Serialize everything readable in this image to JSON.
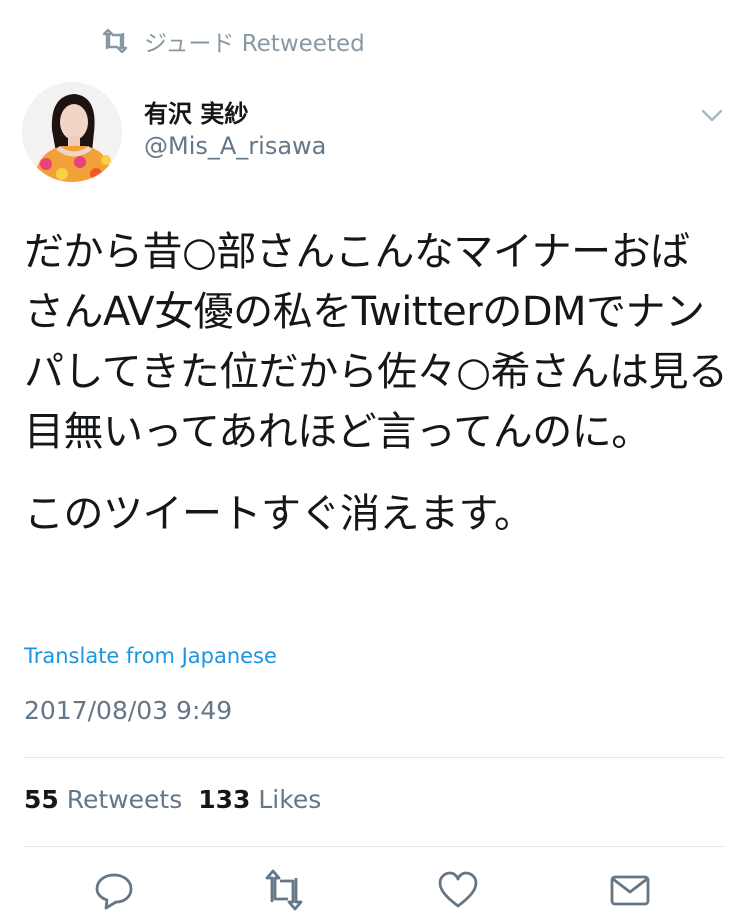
{
  "retweet_context": {
    "icon": "retweet-icon",
    "text": "ジュード Retweeted"
  },
  "author": {
    "display_name": "有沢 実紗",
    "handle": "@Mis_A_risawa"
  },
  "tweet": {
    "paragraphs": [
      "だから昔○部さんこんなマイナーおばさんAV女優の私をTwitterのDMでナンパしてきた位だから佐々○希さんは見る目無いってあれほど言ってんのに。",
      "このツイートすぐ消えます。"
    ],
    "translate_label": "Translate from Japanese",
    "timestamp": "2017/08/03 9:49"
  },
  "stats": {
    "retweets_count": "55",
    "retweets_label": "Retweets",
    "likes_count": "133",
    "likes_label": "Likes"
  },
  "actions": [
    "reply-icon",
    "retweet-icon",
    "like-icon",
    "message-icon"
  ],
  "colors": {
    "link": "#1b95e0",
    "secondary_text": "#657786",
    "icon_gray": "#8899a6",
    "divider": "#e1e8ed"
  }
}
